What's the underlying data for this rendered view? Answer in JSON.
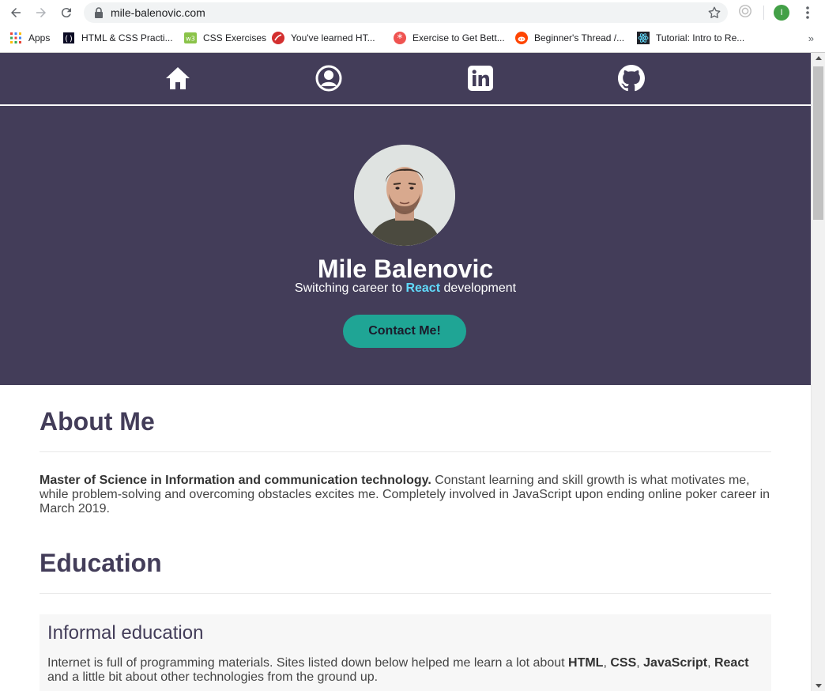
{
  "browser": {
    "url": "mile-balenovic.com",
    "profile_initial": "I",
    "bookmarks": [
      {
        "label": "Apps",
        "icon": "apps-grid-icon"
      },
      {
        "label": "HTML & CSS Practi...",
        "icon": "freecodecamp-icon"
      },
      {
        "label": "CSS Exercises",
        "icon": "w3resource-icon"
      },
      {
        "label": "You've learned HT...",
        "icon": "codecademy-icon"
      },
      {
        "label": "Exercise to Get Bett...",
        "icon": "asterisk-icon"
      },
      {
        "label": "Beginner's Thread /...",
        "icon": "reddit-icon"
      },
      {
        "label": "Tutorial: Intro to Re...",
        "icon": "react-icon"
      }
    ]
  },
  "site": {
    "colors": {
      "header": "#433d59",
      "accent": "#1fa595",
      "react": "#61dafb"
    },
    "nav": [
      {
        "name": "home",
        "icon": "home-icon"
      },
      {
        "name": "profile",
        "icon": "user-circle-icon"
      },
      {
        "name": "linkedin",
        "icon": "linkedin-icon"
      },
      {
        "name": "github",
        "icon": "github-icon"
      }
    ],
    "hero": {
      "name": "Mile Balenovic",
      "subtitle_pre": "Switching career to ",
      "subtitle_highlight": "React",
      "subtitle_post": " development",
      "button": "Contact Me!"
    },
    "about": {
      "heading": "About Me",
      "bold": "Master of Science in Information and communication technology.",
      "text": " Constant learning and skill growth is what motivates me, while problem-solving and overcoming obstacles excites me. Completely involved in JavaScript upon ending online poker career in March 2019."
    },
    "education": {
      "heading": "Education",
      "card_title": "Informal education",
      "text_pre": "Internet is full of programming materials. Sites listed down below helped me learn a lot about ",
      "tech": [
        "HTML",
        "CSS",
        "JavaScript",
        "React"
      ],
      "sep": ", ",
      "text_post": " and a little bit about other technologies from the ground up."
    }
  }
}
